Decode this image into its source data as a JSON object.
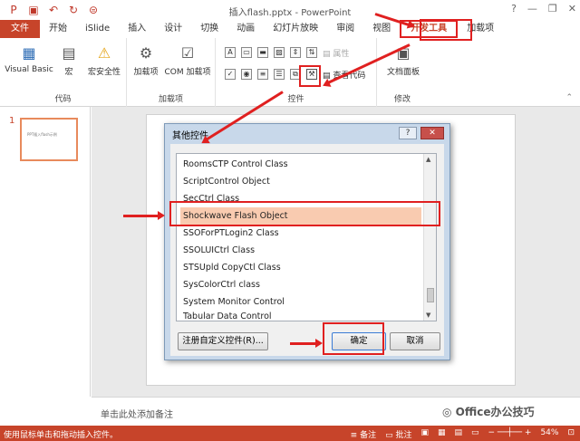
{
  "window": {
    "title": "插入flash.pptx - PowerPoint",
    "help": "?",
    "minimize": "—",
    "restore": "❐",
    "close": "✕"
  },
  "tabs": [
    "文件",
    "开始",
    "iSlide",
    "插入",
    "设计",
    "切换",
    "动画",
    "幻灯片放映",
    "审阅",
    "视图",
    "开发工具",
    "加载项"
  ],
  "ribbon": {
    "code": {
      "label": "代码",
      "vb": "Visual Basic",
      "macro": "宏",
      "security": "宏安全性"
    },
    "addins": {
      "label": "加载项",
      "addin": "加载项",
      "com": "COM 加载项"
    },
    "controls": {
      "label": "控件",
      "properties": "属性",
      "view_code": "查看代码"
    },
    "modify": {
      "label": "修改",
      "doc_panel": "文档面板"
    }
  },
  "slide": {
    "number": "1",
    "thumb_text": "PPT插入flash示例"
  },
  "dialog": {
    "title": "其他控件",
    "help": "?",
    "close": "✕",
    "items": [
      "RoomsCTP Control Class",
      "ScriptControl Object",
      "SecCtrl Class",
      "Shockwave Flash Object",
      "SSOForPTLogin2 Class",
      "SSOLUICtrl Class",
      "STSUpld CopyCtl Class",
      "SysColorCtrl class",
      "System Monitor Control",
      "Tabular Data Control"
    ],
    "register": "注册自定义控件(R)...",
    "ok": "确定",
    "cancel": "取消"
  },
  "notes": {
    "placeholder": "单击此处添加备注"
  },
  "status": {
    "hint": "使用鼠标单击和拖动插入控件。",
    "notes": "备注",
    "comments": "批注",
    "zoom": "54%"
  },
  "watermark": "Office办公技巧"
}
